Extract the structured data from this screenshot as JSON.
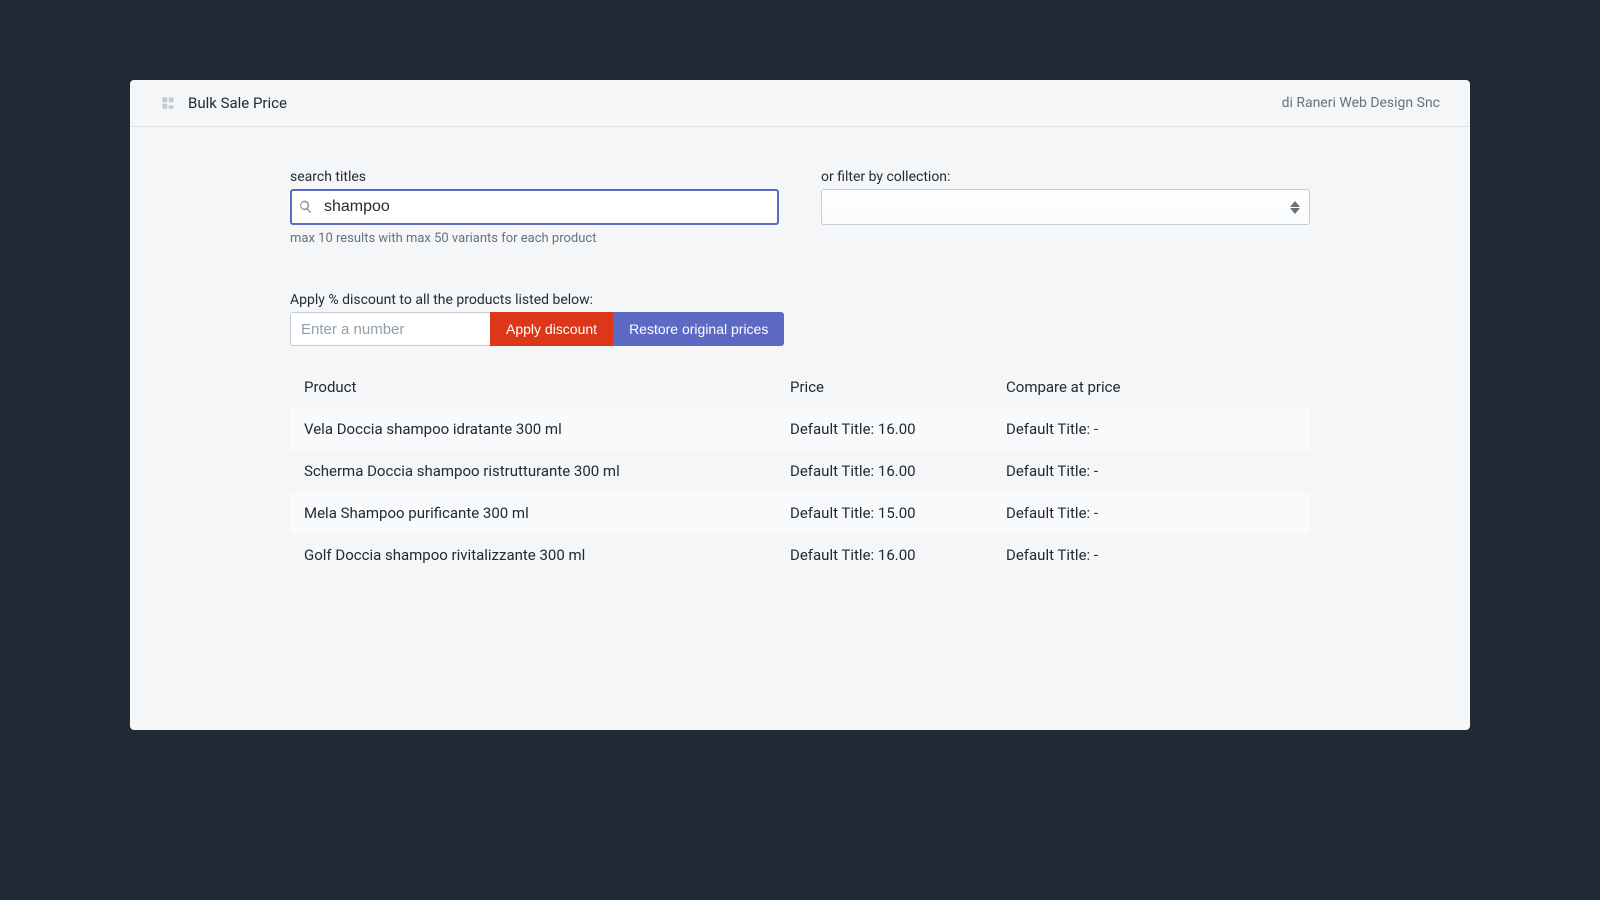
{
  "header": {
    "title": "Bulk Sale Price",
    "vendor": "di Raneri Web Design Snc"
  },
  "search": {
    "label": "search titles",
    "value": "shampoo",
    "help": "max 10 results with max 50 variants for each product"
  },
  "collection": {
    "label": "or filter by collection:",
    "value": ""
  },
  "discount": {
    "label": "Apply % discount to all the products listed below:",
    "placeholder": "Enter a number",
    "apply": "Apply discount",
    "restore": "Restore original prices"
  },
  "table": {
    "headers": {
      "product": "Product",
      "price": "Price",
      "compare": "Compare at price"
    },
    "rows": [
      {
        "product": "Vela Doccia shampoo idratante 300 ml",
        "price": "Default Title: 16.00",
        "compare": "Default Title: -"
      },
      {
        "product": "Scherma Doccia shampoo ristrutturante 300 ml",
        "price": "Default Title: 16.00",
        "compare": "Default Title: -"
      },
      {
        "product": "Mela Shampoo purificante 300 ml",
        "price": "Default Title: 15.00",
        "compare": "Default Title: -"
      },
      {
        "product": "Golf Doccia shampoo rivitalizzante 300 ml",
        "price": "Default Title: 16.00",
        "compare": "Default Title: -"
      }
    ]
  }
}
